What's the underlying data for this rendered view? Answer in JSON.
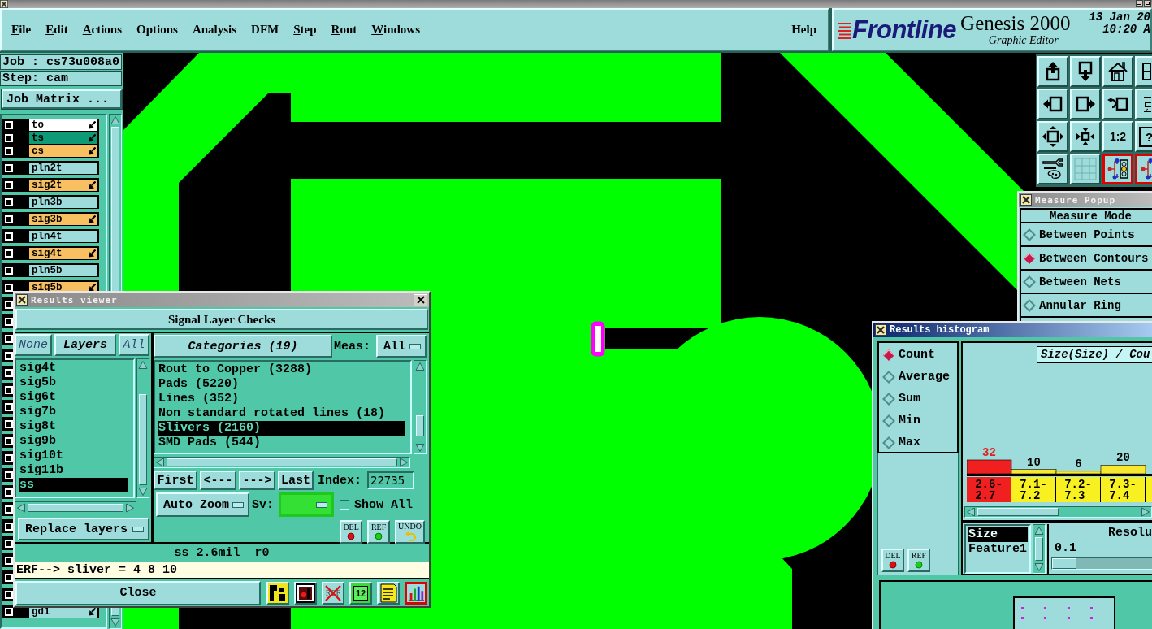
{
  "menu_bar": {
    "items": [
      {
        "label": "File",
        "mnemonic": true
      },
      {
        "label": "Edit",
        "mnemonic": true
      },
      {
        "label": "Actions",
        "mnemonic": true
      },
      {
        "label": "Options",
        "mnemonic": false
      },
      {
        "label": "Analysis",
        "mnemonic": false
      },
      {
        "label": "DFM",
        "mnemonic": false
      },
      {
        "label": "Step",
        "mnemonic": true
      },
      {
        "label": "Rout",
        "mnemonic": true
      },
      {
        "label": "Windows",
        "mnemonic": true
      }
    ],
    "help": {
      "label": "Help",
      "mnemonic": false
    }
  },
  "brand": {
    "logo": "Frontline",
    "product": "Genesis 2000",
    "subtitle": "Graphic Editor",
    "date": "13 Jan 20",
    "time": "10:20 A"
  },
  "job_panel": {
    "job": "Job : cs73u008a0",
    "step": "Step: cam",
    "matrix_button": "Job Matrix ...",
    "layer_groups": [
      {
        "layers": [
          {
            "label": "to",
            "color": "#ffffff",
            "checked": false,
            "arrow": true
          },
          {
            "label": "ts",
            "color": "#0e9a76",
            "checked": false,
            "arrow": true
          },
          {
            "label": "cs",
            "color": "#f8c060",
            "checked": false,
            "arrow": true
          }
        ]
      },
      {
        "layers": [
          {
            "label": "pln2t",
            "color": "#9edcdc",
            "checked": false,
            "arrow": false
          }
        ]
      },
      {
        "layers": [
          {
            "label": "sig2t",
            "color": "#f8c060",
            "checked": false,
            "arrow": true
          }
        ]
      },
      {
        "layers": [
          {
            "label": "pln3b",
            "color": "#9edcdc",
            "checked": false,
            "arrow": false
          }
        ]
      },
      {
        "layers": [
          {
            "label": "sig3b",
            "color": "#f8c060",
            "checked": false,
            "arrow": true
          }
        ]
      },
      {
        "layers": [
          {
            "label": "pln4t",
            "color": "#9edcdc",
            "checked": false,
            "arrow": false
          }
        ]
      },
      {
        "layers": [
          {
            "label": "sig4t",
            "color": "#f8c060",
            "checked": false,
            "arrow": true
          }
        ]
      },
      {
        "layers": [
          {
            "label": "pln5b",
            "color": "#9edcdc",
            "checked": false,
            "arrow": false
          }
        ]
      },
      {
        "layers": [
          {
            "label": "sig5b",
            "color": "#f8c060",
            "checked": false,
            "arrow": true
          }
        ]
      },
      {
        "layers": [
          {
            "checked": false
          }
        ]
      },
      {
        "layers": [
          {
            "checked": false
          }
        ]
      },
      {
        "layers": [
          {
            "checked": false
          }
        ]
      },
      {
        "layers": [
          {
            "checked": false
          }
        ]
      },
      {
        "layers": [
          {
            "checked": false
          }
        ]
      },
      {
        "layers": [
          {
            "checked": false
          }
        ]
      },
      {
        "layers": [
          {
            "checked": false
          }
        ]
      },
      {
        "layers": [
          {
            "checked": false
          }
        ]
      },
      {
        "layers": [
          {
            "checked": false
          }
        ]
      },
      {
        "layers": [
          {
            "checked": false
          }
        ]
      },
      {
        "layers": [
          {
            "checked": false
          }
        ]
      },
      {
        "layers": [
          {
            "checked": false
          }
        ]
      },
      {
        "layers": [
          {
            "checked": false
          }
        ]
      },
      {
        "layers": [
          {
            "checked": false
          }
        ]
      },
      {
        "layers": [
          {
            "checked": false
          }
        ]
      },
      {
        "layers": [
          {
            "checked": false
          }
        ]
      },
      {
        "layers": [
          {
            "checked": false
          }
        ]
      },
      {
        "layers": [
          {
            "checked": false
          }
        ]
      },
      {
        "layers": [
          {
            "label": "gd1",
            "color": "#9edcdc",
            "checked": false,
            "arrow": true
          }
        ]
      }
    ]
  },
  "toolbar": {
    "buttons": [
      {
        "kind": "upload",
        "selected": false
      },
      {
        "kind": "download",
        "selected": false
      },
      {
        "kind": "home",
        "selected": false
      },
      {
        "kind": "panel",
        "selected": false
      },
      {
        "kind": "arrow_left",
        "selected": false
      },
      {
        "kind": "arrow_right",
        "selected": false
      },
      {
        "kind": "undo",
        "selected": false
      },
      {
        "kind": "bracket",
        "selected": false
      },
      {
        "kind": "expand",
        "selected": false
      },
      {
        "kind": "shrink",
        "selected": false
      },
      {
        "kind": "text",
        "label": "1:2",
        "selected": false
      },
      {
        "kind": "text",
        "label": "?",
        "selected": false
      },
      {
        "kind": "tools",
        "selected": false
      },
      {
        "kind": "grid",
        "selected": false
      },
      {
        "kind": "circuit",
        "selected": true
      },
      {
        "kind": "circuit",
        "selected": true
      }
    ]
  },
  "results_viewer": {
    "title": "Results viewer",
    "active": false,
    "header": "Signal Layer Checks",
    "layer_buttons": [
      {
        "label": "None",
        "kind": "none"
      },
      {
        "label": "Layers",
        "kind": "title"
      },
      {
        "label": "All",
        "kind": "all"
      }
    ],
    "layers": [
      {
        "label": "sig4t",
        "selected": false
      },
      {
        "label": "sig5b",
        "selected": false
      },
      {
        "label": "sig6t",
        "selected": false
      },
      {
        "label": "sig7b",
        "selected": false
      },
      {
        "label": "sig8t",
        "selected": false
      },
      {
        "label": "sig9b",
        "selected": false
      },
      {
        "label": "sig10t",
        "selected": false
      },
      {
        "label": "sig11b",
        "selected": false
      },
      {
        "label": "ss",
        "selected": true
      }
    ],
    "layer_mode": "Replace layers",
    "categories_button": "Categories (19)",
    "meas_label": "Meas:",
    "meas_value": "All",
    "categories": [
      {
        "label": "Rout to Copper (3288)",
        "selected": false
      },
      {
        "label": "Pads (5220)",
        "selected": false
      },
      {
        "label": "Lines (352)",
        "selected": false
      },
      {
        "label": "Non standard rotated lines (18)",
        "selected": false
      },
      {
        "label": "Slivers (2160)",
        "selected": true
      },
      {
        "label": "SMD Pads (544)",
        "selected": false
      }
    ],
    "nav_buttons": [
      "First",
      "<---",
      "--->",
      "Last"
    ],
    "index_label": "Index:",
    "index_value": "22735",
    "zoom_mode": "Auto Zoom",
    "sv_label": "Sv:",
    "show_all": {
      "label": "Show All",
      "checked": false
    },
    "actions": [
      {
        "kind": "del",
        "label": "DEL"
      },
      {
        "kind": "ref",
        "label": "REF"
      },
      {
        "kind": "undo",
        "label": "UNDO"
      }
    ],
    "status": "ss 2.6mil  r0",
    "erf": "ERF--> sliver = 4 8 10",
    "close": "Close",
    "tools": [
      {
        "kind": "blocks",
        "selected": false
      },
      {
        "kind": "marker",
        "selected": false
      },
      {
        "kind": "ref_off",
        "label": "REF",
        "selected": false
      },
      {
        "kind": "page",
        "label": "12",
        "selected": false
      },
      {
        "kind": "notes",
        "selected": false
      },
      {
        "kind": "chart",
        "selected": true
      }
    ]
  },
  "measure_popup": {
    "title": "Measure Popup",
    "active": false,
    "heading": "Measure Mode",
    "modes": [
      {
        "label": "Between Points",
        "selected": false
      },
      {
        "label": "Between Contours",
        "selected": true
      },
      {
        "label": "Between Nets",
        "selected": false
      },
      {
        "label": "Annular Ring",
        "selected": false
      }
    ]
  },
  "results_histogram": {
    "title": "Results histogram",
    "active": true,
    "functions": [
      {
        "label": "Count",
        "selected": true
      },
      {
        "label": "Average",
        "selected": false
      },
      {
        "label": "Sum",
        "selected": false
      },
      {
        "label": "Min",
        "selected": false
      },
      {
        "label": "Max",
        "selected": false
      }
    ],
    "actions": [
      {
        "kind": "del",
        "label": "DEL"
      },
      {
        "kind": "ref",
        "label": "REF"
      }
    ],
    "chart_data": {
      "type": "bar",
      "title": "Size(Size) / Cou",
      "categories": [
        "2.6-2.7",
        "7.1-7.2",
        "7.2-7.3",
        "7.3-7.4"
      ],
      "values": [
        32,
        10,
        6,
        20
      ],
      "ylim": [
        0,
        250
      ],
      "data_labels": true
    },
    "bins": [
      {
        "selected": true
      },
      {
        "selected": false
      },
      {
        "selected": false
      },
      {
        "selected": false
      },
      {
        "selected": false
      }
    ],
    "fields": [
      {
        "label": "Size",
        "selected": true
      },
      {
        "label": "Feature1",
        "selected": false
      }
    ],
    "resolution_label": "Resolu",
    "resolution_value": "0.1",
    "resolution": {
      "level": 0
    }
  }
}
